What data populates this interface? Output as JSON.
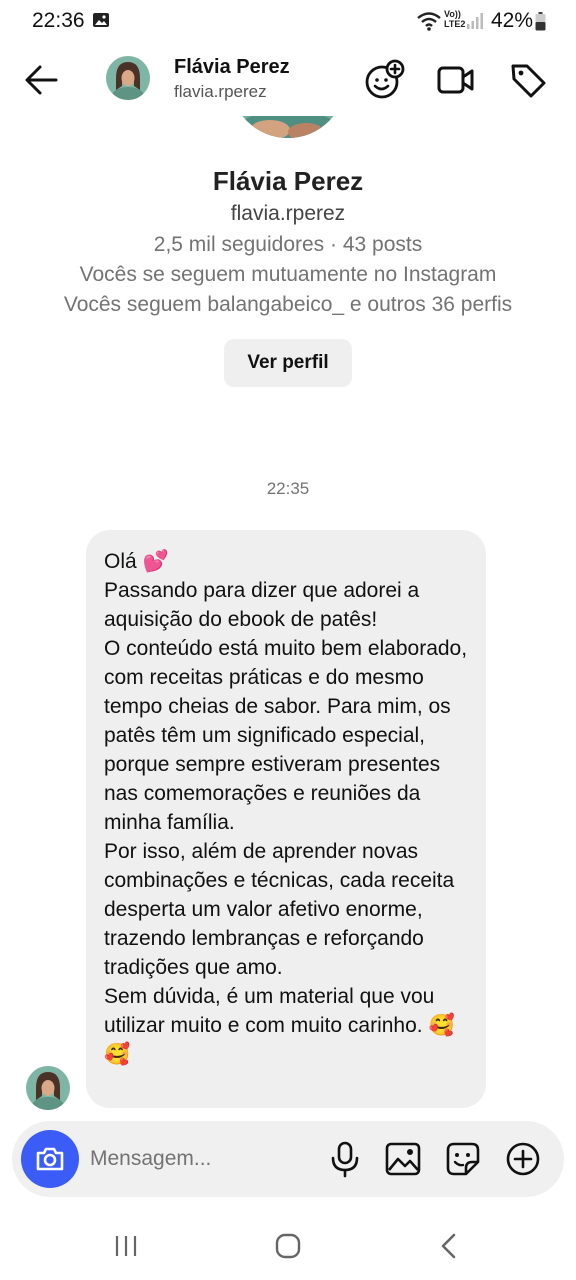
{
  "status_bar": {
    "time": "22:36",
    "network": "Vo)) LTE2",
    "battery": "42%"
  },
  "header": {
    "name": "Flávia Perez",
    "username": "flavia.rperez",
    "icons": [
      "back-arrow-icon",
      "effects-face-icon",
      "video-camera-icon",
      "tag-icon"
    ]
  },
  "profile": {
    "name": "Flávia Perez",
    "username": "flavia.rperez",
    "stats": "2,5 mil seguidores · 43 posts",
    "mutual_follow": "Vocês se seguem mutuamente no Instagram",
    "mutual_friends": "Vocês seguem balangabeico_ e outros 36 perfis",
    "view_profile_label": "Ver perfil"
  },
  "chat": {
    "timestamp": "22:35",
    "message": "Olá 💕\nPassando para dizer que adorei a aquisição do ebook de patês!\nO conteúdo está muito bem elaborado, com receitas práticas e do mesmo tempo cheias de sabor. Para mim, os patês têm um significado especial, porque sempre estiveram presentes nas comemorações e reuniões da minha família.\nPor isso, além de aprender novas combinações e técnicas, cada receita desperta um valor afetivo enorme, trazendo lembranças e reforçando tradições que amo.\nSem dúvida, é um material que vou utilizar muito e com muito carinho. 🥰🥰"
  },
  "composer": {
    "placeholder": "Mensagem..."
  },
  "colors": {
    "accent": "#3b5cf6",
    "bubble": "#efefef",
    "composer_bg": "#f0f0f0",
    "secondary_text": "#737373"
  }
}
